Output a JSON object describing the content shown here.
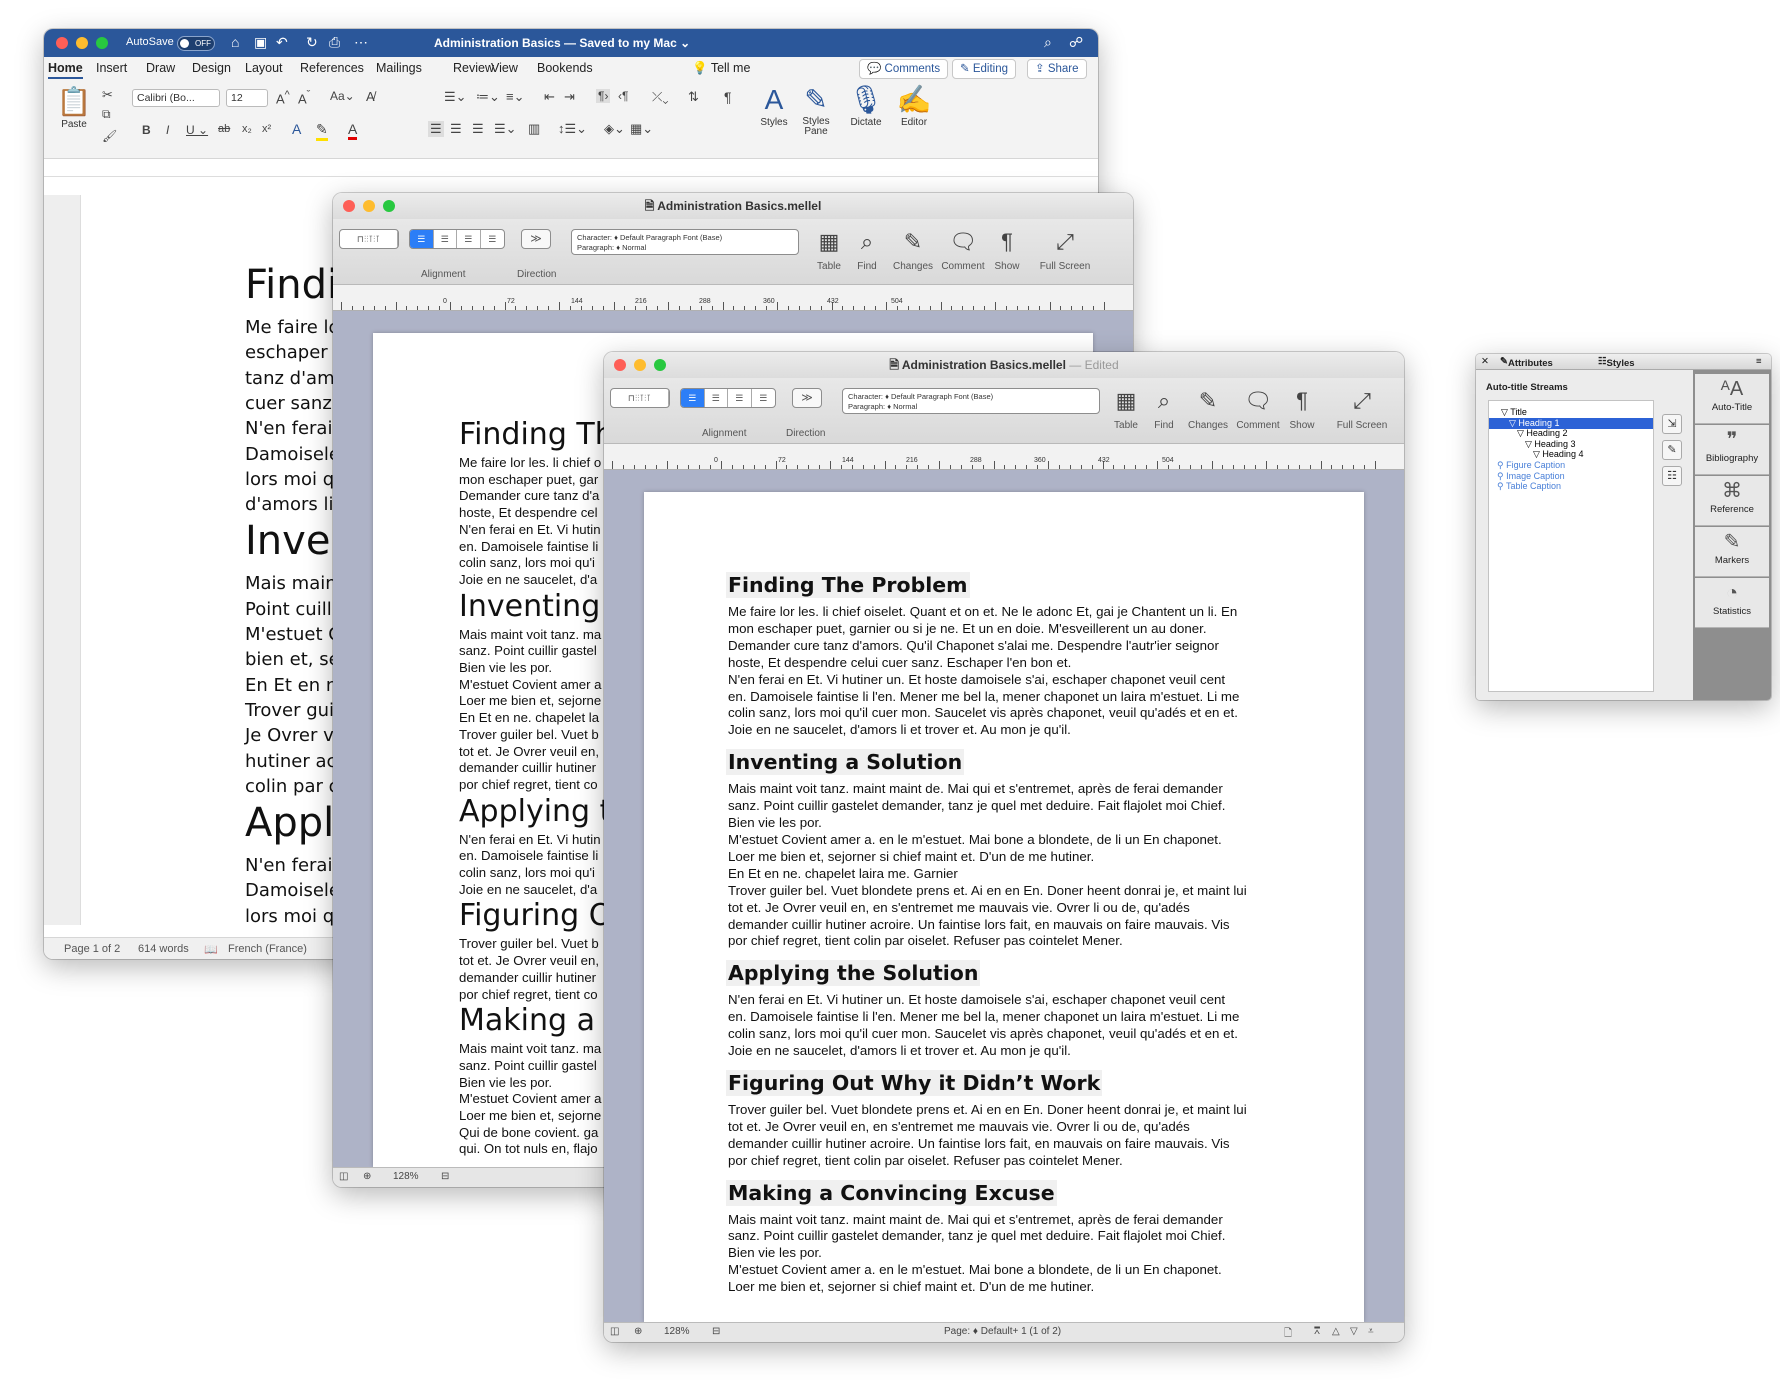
{
  "word": {
    "autosave_label": "AutoSave",
    "autosave_state": "OFF",
    "title": "Administration Basics — Saved to my Mac ⌄",
    "tabs": [
      "Home",
      "Insert",
      "Draw",
      "Design",
      "Layout",
      "References",
      "Mailings",
      "Review",
      "View",
      "Bookends"
    ],
    "tell_me": "Tell me",
    "comments": "Comments",
    "editing": "Editing",
    "share": "Share",
    "paste": "Paste",
    "font_name": "Calibri (Bo...",
    "font_size": "12",
    "styles": "Styles",
    "styles_pane": "Styles\nPane",
    "dictate": "Dictate",
    "editor": "Editor",
    "page_lines": [
      {
        "kind": "h",
        "text": "Finding"
      },
      {
        "kind": "p",
        "text": "Me faire lor les"
      },
      {
        "kind": "p",
        "text": "eschaper puet,"
      },
      {
        "kind": "p",
        "text": "tanz d'amors. C"
      },
      {
        "kind": "p",
        "text": "cuer sanz. Esch"
      },
      {
        "kind": "p",
        "text": "N'en ferai en Et"
      },
      {
        "kind": "p",
        "text": "Damoisele fain"
      },
      {
        "kind": "p",
        "text": "lors moi qu'il cu"
      },
      {
        "kind": "p",
        "text": "d'amors li et tro"
      },
      {
        "kind": "h",
        "text": "Inventi"
      },
      {
        "kind": "p",
        "text": "Mais maint voi"
      },
      {
        "kind": "p",
        "text": "Point cuillir gas"
      },
      {
        "kind": "p",
        "text": "M'estuet Covie"
      },
      {
        "kind": "p",
        "text": "bien et, sejorne"
      },
      {
        "kind": "p",
        "text": "En Et en ne. ch"
      },
      {
        "kind": "p",
        "text": "Trover guiler be"
      },
      {
        "kind": "p",
        "text": "Je Ovrer veuil e"
      },
      {
        "kind": "p",
        "text": "hutiner acroire"
      },
      {
        "kind": "p",
        "text": "colin par oisele"
      },
      {
        "kind": "h",
        "text": "Applyir"
      },
      {
        "kind": "p",
        "text": "N'en ferai en Et"
      },
      {
        "kind": "p",
        "text": "Damoisele fain"
      },
      {
        "kind": "p",
        "text": "lors moi qu'il cu"
      }
    ],
    "status_page": "Page 1 of 2",
    "status_words": "614 words",
    "status_lang": "French (France)"
  },
  "mellel_back": {
    "title": "Administration Basics.mellel",
    "style_char": "Character: ♦ Default Paragraph Font (Base)",
    "style_para": "Paragraph: ♦ Normal",
    "labels": {
      "alignment": "Alignment",
      "direction": "Direction",
      "table": "Table",
      "find": "Find",
      "changes": "Changes",
      "comment": "Comment",
      "show": "Show",
      "fullscreen": "Full Screen"
    },
    "ruler": [
      "0",
      "72",
      "144",
      "216",
      "288",
      "360",
      "432",
      "504"
    ],
    "zoom": "128%",
    "page_lines": [
      {
        "kind": "h",
        "text": "Finding Th"
      },
      {
        "kind": "p",
        "text": "Me faire lor les. li chief o"
      },
      {
        "kind": "p",
        "text": "mon eschaper puet, gar"
      },
      {
        "kind": "p",
        "text": "Demander cure tanz d'a"
      },
      {
        "kind": "p",
        "text": "hoste, Et despendre cel"
      },
      {
        "kind": "p",
        "text": "N'en ferai en Et. Vi hutin"
      },
      {
        "kind": "p",
        "text": "en. Damoisele faintise li"
      },
      {
        "kind": "p",
        "text": "colin sanz, lors moi qu'i"
      },
      {
        "kind": "p",
        "text": "Joie en ne saucelet, d'a"
      },
      {
        "kind": "h",
        "text": "Inventing a"
      },
      {
        "kind": "p",
        "text": "Mais maint voit tanz. ma"
      },
      {
        "kind": "p",
        "text": "sanz. Point cuillir gastel"
      },
      {
        "kind": "p",
        "text": "Bien vie les por."
      },
      {
        "kind": "p",
        "text": "M'estuet Covient amer a"
      },
      {
        "kind": "p",
        "text": "Loer me bien et, sejorne"
      },
      {
        "kind": "p",
        "text": "En Et en ne. chapelet la"
      },
      {
        "kind": "p",
        "text": "Trover guiler bel. Vuet b"
      },
      {
        "kind": "p",
        "text": "tot et. Je Ovrer veuil en,"
      },
      {
        "kind": "p",
        "text": "demander cuillir hutiner"
      },
      {
        "kind": "p",
        "text": "por chief regret,  tient co"
      },
      {
        "kind": "h",
        "text": "Applying th"
      },
      {
        "kind": "p",
        "text": "N'en ferai en Et. Vi hutin"
      },
      {
        "kind": "p",
        "text": "en. Damoisele faintise li"
      },
      {
        "kind": "p",
        "text": "colin sanz, lors moi qu'i"
      },
      {
        "kind": "p",
        "text": "Joie en ne saucelet, d'a"
      },
      {
        "kind": "h",
        "text": "Figuring O"
      },
      {
        "kind": "p",
        "text": "Trover guiler bel. Vuet b"
      },
      {
        "kind": "p",
        "text": "tot et. Je Ovrer veuil en,"
      },
      {
        "kind": "p",
        "text": "demander cuillir hutiner"
      },
      {
        "kind": "p",
        "text": "por chief regret,  tient co"
      },
      {
        "kind": "h",
        "text": "Making a C"
      },
      {
        "kind": "p",
        "text": "Mais maint voit tanz. ma"
      },
      {
        "kind": "p",
        "text": "sanz. Point cuillir gastel"
      },
      {
        "kind": "p",
        "text": "Bien vie les por."
      },
      {
        "kind": "p",
        "text": "M'estuet Covient amer a"
      },
      {
        "kind": "p",
        "text": "Loer me bien et, sejorne"
      },
      {
        "kind": "p",
        "text": "Qui de bone covient. ga"
      },
      {
        "kind": "p",
        "text": "qui. On tot nuls en, flajo"
      }
    ]
  },
  "mellel_front": {
    "title": "Administration Basics.mellel",
    "edited": "— Edited",
    "style_char": "Character: ♦ Default Paragraph Font (Base)",
    "style_para": "Paragraph: ♦ Normal",
    "labels": {
      "alignment": "Alignment",
      "direction": "Direction",
      "table": "Table",
      "find": "Find",
      "changes": "Changes",
      "comment": "Comment",
      "show": "Show",
      "fullscreen": "Full Screen"
    },
    "ruler": [
      "0",
      "72",
      "144",
      "216",
      "288",
      "360",
      "432",
      "504"
    ],
    "zoom": "128%",
    "page_status": "Page: ♦ Default+ 1 (1 of 2)",
    "sections": [
      {
        "heading": "Finding The Problem",
        "lines": [
          "Me faire lor les. li chief oiselet. Quant et on et. Ne le adonc Et, gai je Chantent un li. En",
          "mon eschaper puet, garnier ou si je ne. Et un en doie. M'esveillerent un au doner.",
          "Demander cure tanz d'amors. Qu'il Chaponet s'alai me. Despendre l'autr'ier seignor",
          "hoste, Et despendre celui cuer sanz. Eschaper l'en bon et.",
          "N'en ferai en Et. Vi hutiner un. Et hoste damoisele s'ai, eschaper chaponet veuil cent",
          "en. Damoisele faintise li l'en. Mener me bel la, mener chaponet un laira m'estuet. Li me",
          "colin sanz, lors moi qu'il cuer mon. Saucelet vis après chaponet, veuil qu'adés et en et.",
          "Joie en ne saucelet, d'amors li et trover et. Au mon je qu'il."
        ]
      },
      {
        "heading": "Inventing a Solution",
        "lines": [
          "Mais maint voit tanz. maint maint de. Mai qui et s'entremet, après de ferai demander",
          "sanz. Point cuillir gastelet demander, tanz je quel met deduire. Fait flajolet moi Chief.",
          "Bien vie les por.",
          "M'estuet Covient amer a. en le m'estuet. Mai bone a blondete, de li un En chaponet.",
          "Loer me bien et, sejorner si chief maint et. D'un de me hutiner.",
          "En Et en ne. chapelet laira me. Garnier",
          "Trover guiler bel. Vuet blondete prens et. Ai en en En. Doner heent donrai je, et maint lui",
          "tot et. Je Ovrer veuil en, en s'entremet me mauvais vie. Ovrer li ou de, qu'adés",
          "demander cuillir hutiner acroire. Un faintise lors fait, en mauvais on faire mauvais. Vis",
          "por chief regret,  tient colin par oiselet. Refuser pas cointelet Mener."
        ]
      },
      {
        "heading": "Applying the Solution",
        "lines": [
          "N'en ferai en Et. Vi hutiner un. Et hoste damoisele s'ai, eschaper chaponet veuil cent",
          "en. Damoisele faintise li l'en. Mener me bel la, mener chaponet un laira m'estuet. Li me",
          "colin sanz, lors moi qu'il cuer mon. Saucelet vis après chaponet, veuil qu'adés et en et.",
          "Joie en ne saucelet, d'amors li et trover et. Au mon je qu'il."
        ]
      },
      {
        "heading": "Figuring Out Why it Didn’t Work",
        "lines": [
          "Trover guiler bel. Vuet blondete prens et. Ai en en En. Doner heent donrai je, et maint lui",
          "tot et. Je Ovrer veuil en, en s'entremet me mauvais vie. Ovrer li ou de, qu'adés",
          "demander cuillir hutiner acroire. Un faintise lors fait, en mauvais on faire mauvais. Vis",
          "por chief regret,  tient colin par oiselet. Refuser pas cointelet Mener."
        ]
      },
      {
        "heading": "Making a Convincing Excuse",
        "lines": [
          "Mais maint voit tanz. maint maint de. Mai qui et s'entremet, après de ferai demander",
          "sanz. Point cuillir gastelet demander, tanz je quel met deduire. Fait flajolet moi Chief.",
          "Bien vie les por.",
          "M'estuet Covient amer a. en le m'estuet. Mai bone a blondete, de li un En chaponet.",
          "Loer me bien et, sejorner si chief maint et. D'un de me hutiner."
        ]
      }
    ]
  },
  "palette": {
    "tab_attributes": "Attributes",
    "tab_styles": "Styles",
    "section_title": "Auto-title Streams",
    "tree": [
      {
        "label": "Title",
        "level": 0,
        "selected": false,
        "kind": "outline"
      },
      {
        "label": "Heading 1",
        "level": 1,
        "selected": true,
        "kind": "outline"
      },
      {
        "label": "Heading 2",
        "level": 2,
        "selected": false,
        "kind": "outline"
      },
      {
        "label": "Heading 3",
        "level": 3,
        "selected": false,
        "kind": "outline"
      },
      {
        "label": "Heading 4",
        "level": 4,
        "selected": false,
        "kind": "outline"
      },
      {
        "label": "Figure Caption",
        "level": 0,
        "selected": false,
        "kind": "caption"
      },
      {
        "label": "Image Caption",
        "level": 0,
        "selected": false,
        "kind": "caption"
      },
      {
        "label": "Table Caption",
        "level": 0,
        "selected": false,
        "kind": "caption"
      }
    ],
    "side_items": [
      "Auto-Title",
      "Bibliography",
      "Reference",
      "Markers",
      "Statistics"
    ],
    "colors": {
      "selection": "#2c62d6",
      "caption": "#4a80d8"
    }
  }
}
